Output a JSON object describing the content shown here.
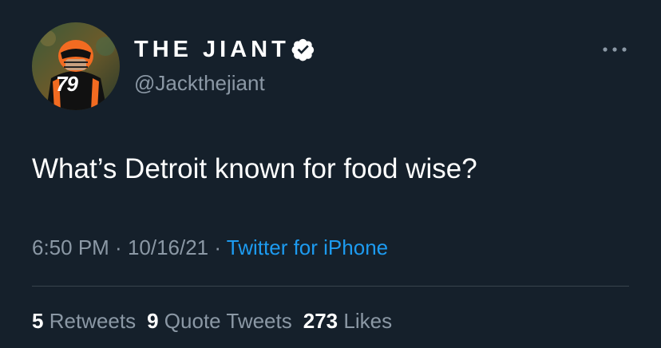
{
  "author": {
    "display_name": "THE JIANT",
    "handle": "@Jackthejiant",
    "verified_icon": "verified-badge-icon",
    "avatar_jersey_number": "79"
  },
  "tweet": {
    "text": "What’s Detroit known for food wise?"
  },
  "meta": {
    "time": "6:50 PM",
    "sep1": " · ",
    "date": "10/16/21",
    "sep2": " · ",
    "source": "Twitter for iPhone"
  },
  "stats": {
    "retweets_count": "5",
    "retweets_label": "Retweets",
    "quote_count": "9",
    "quote_label": "Quote Tweets",
    "likes_count": "273",
    "likes_label": "Likes"
  },
  "colors": {
    "background": "#15202b",
    "text_primary": "#ffffff",
    "text_secondary": "#8b98a5",
    "link": "#1d9bf0",
    "divider": "#38444d"
  }
}
